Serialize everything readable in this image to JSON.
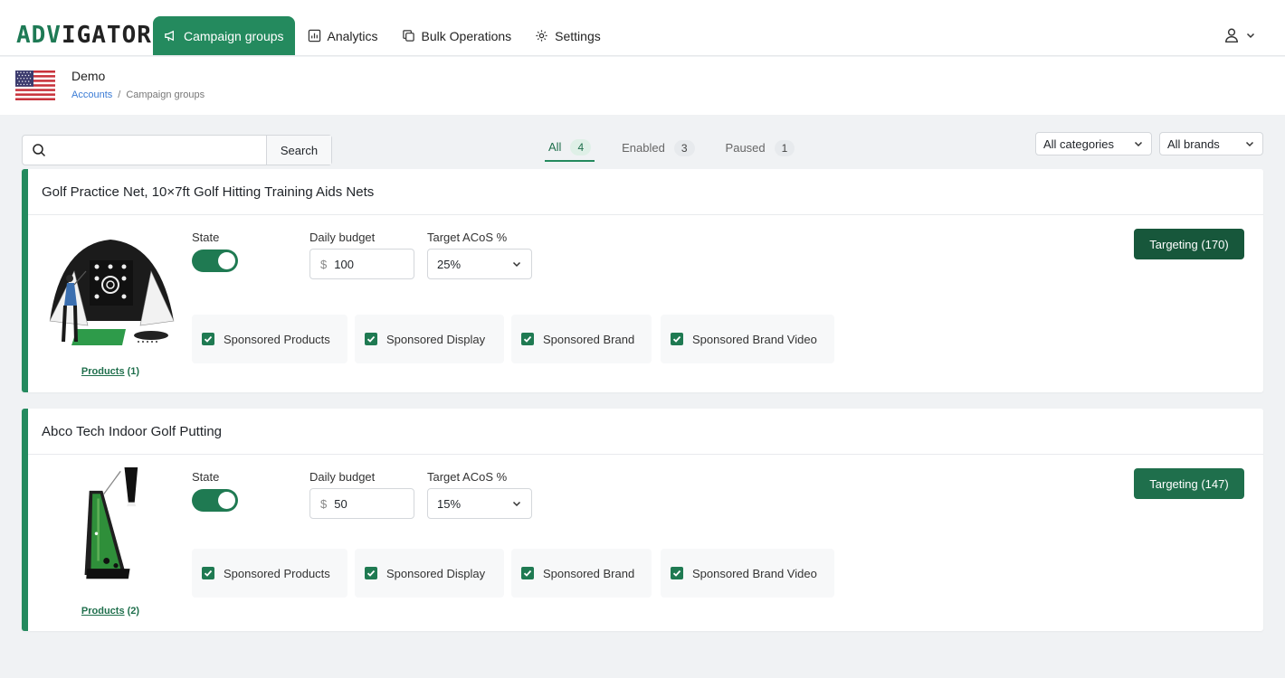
{
  "app": {
    "logo_part1": "ADV",
    "logo_part2": "IGATOR",
    "accent_color": "#248a5e"
  },
  "nav": {
    "items": [
      {
        "label": "Campaign groups",
        "icon": "megaphone-icon",
        "active": true
      },
      {
        "label": "Analytics",
        "icon": "bar-chart-icon",
        "active": false
      },
      {
        "label": "Bulk Operations",
        "icon": "copy-icon",
        "active": false
      },
      {
        "label": "Settings",
        "icon": "gear-icon",
        "active": false
      }
    ]
  },
  "account": {
    "name": "Demo",
    "flag": "us-flag-icon",
    "breadcrumb": [
      "Accounts",
      "Campaign groups"
    ]
  },
  "search": {
    "value": "",
    "placeholder": "",
    "button_label": "Search"
  },
  "tabs": [
    {
      "label": "All",
      "count": "4",
      "active": true
    },
    {
      "label": "Enabled",
      "count": "3",
      "active": false
    },
    {
      "label": "Paused",
      "count": "1",
      "active": false
    }
  ],
  "filters": {
    "categories": "All categories",
    "brands": "All brands"
  },
  "labels": {
    "state": "State",
    "daily_budget": "Daily budget",
    "target_acos": "Target ACoS %",
    "currency": "$"
  },
  "campaigns": [
    {
      "title": "Golf Practice Net, 10×7ft Golf Hitting Training Aids Nets",
      "products_link": "Products",
      "products_count": "(1)",
      "state_on": true,
      "daily_budget": "100",
      "target_acos": "25%",
      "ad_types": [
        "Sponsored Products",
        "Sponsored Display",
        "Sponsored Brand",
        "Sponsored Brand Video"
      ],
      "targeting_label": "Targeting (170)",
      "targeting_color": "#17573b"
    },
    {
      "title": "Abco Tech Indoor Golf Putting",
      "products_link": "Products",
      "products_count": "(2)",
      "state_on": true,
      "daily_budget": "50",
      "target_acos": "15%",
      "ad_types": [
        "Sponsored Products",
        "Sponsored Display",
        "Sponsored Brand",
        "Sponsored Brand Video"
      ],
      "targeting_label": "Targeting (147)",
      "targeting_color": "#1f6f4c"
    }
  ]
}
